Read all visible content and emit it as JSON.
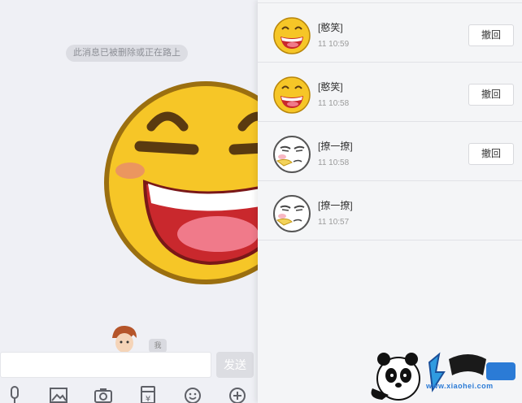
{
  "chat": {
    "recall_notice": "此消息已被删除或正在路上",
    "sender_name": "我",
    "big_emoji_icon": "grinning-face-icon",
    "send_label": "发送"
  },
  "toolbar": {
    "icons": [
      "microphone-icon",
      "image-icon",
      "camera-icon",
      "red-packet-icon",
      "emoji-icon",
      "plus-icon"
    ]
  },
  "panel": {
    "rows": [
      {
        "name": "[憨笑]",
        "time": "11 10:59",
        "icon": "grinning-face-icon",
        "button": "撤回"
      },
      {
        "name": "[憨笑]",
        "time": "11 10:58",
        "icon": "grinning-face-icon",
        "button": "撤回"
      },
      {
        "name": "[撩一撩]",
        "time": "11 10:58",
        "icon": "flirty-face-icon",
        "button": "撤回"
      },
      {
        "name": "[撩一撩]",
        "time": "11 10:57",
        "icon": "flirty-face-icon",
        "button": ""
      }
    ]
  },
  "watermark": {
    "text": "www.xiaohei.com",
    "logo": "panda-logo"
  },
  "colors": {
    "emoji_yellow": "#f6c627",
    "emoji_mouth": "#c9282d",
    "panel_bg": "#f4f5f7",
    "chat_bg": "#eff0f5"
  }
}
